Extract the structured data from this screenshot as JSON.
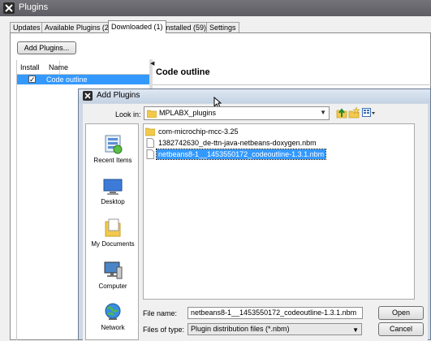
{
  "window": {
    "title": "Plugins"
  },
  "tabs": [
    {
      "label": "Updates"
    },
    {
      "label": "Available Plugins (21)"
    },
    {
      "label": "Downloaded (1)"
    },
    {
      "label": "Installed (59)"
    },
    {
      "label": "Settings"
    }
  ],
  "downloaded": {
    "add_button": "Add Plugins...",
    "columns": {
      "install": "Install",
      "name": "Name"
    },
    "rows": [
      {
        "checked": true,
        "name": "Code outline"
      }
    ],
    "detail_title": "Code outline"
  },
  "dialog": {
    "title": "Add Plugins",
    "look_in_label": "Look in:",
    "look_in_value": "MPLABX_plugins",
    "places": [
      {
        "label": "Recent Items",
        "icon": "recent-items-icon"
      },
      {
        "label": "Desktop",
        "icon": "desktop-icon"
      },
      {
        "label": "My Documents",
        "icon": "documents-icon"
      },
      {
        "label": "Computer",
        "icon": "computer-icon"
      },
      {
        "label": "Network",
        "icon": "network-icon"
      }
    ],
    "files": [
      {
        "name": "com-microchip-mcc-3.25",
        "type": "folder"
      },
      {
        "name": "1382742630_de-ttn-java-netbeans-doxygen.nbm",
        "type": "file"
      },
      {
        "name": "netbeans8-1__1453550172_codeoutline-1.3.1.nbm",
        "type": "file",
        "selected": true
      }
    ],
    "file_name_label": "File name:",
    "file_name_value": "netbeans8-1__1453550172_codeoutline-1.3.1.nbm",
    "file_type_label": "Files of type:",
    "file_type_value": "Plugin distribution files (*.nbm)",
    "open_button": "Open",
    "cancel_button": "Cancel"
  }
}
